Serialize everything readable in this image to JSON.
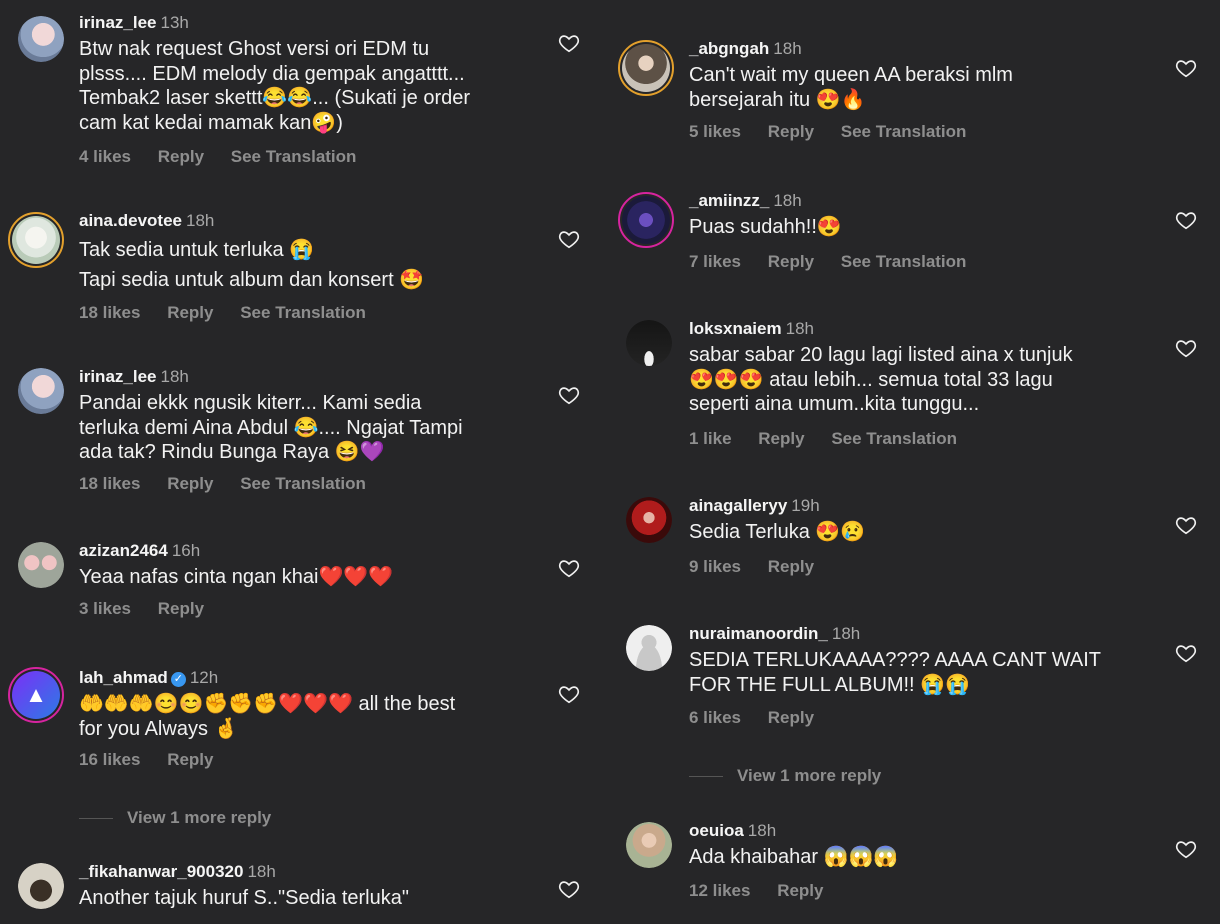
{
  "labels": {
    "reply": "Reply",
    "see_translation": "See Translation"
  },
  "left": {
    "comments": [
      {
        "user": "irinaz_lee",
        "time": "13h",
        "lines": [
          "Btw nak request Ghost versi ori EDM tu",
          "plsss.... EDM melody dia gempak angatttt...",
          "Tembak2 laser skettt😂😂... (Sukati je order",
          "cam kat kedai mamak kan🤪)"
        ],
        "likes": "4 likes",
        "reply": "Reply",
        "translate": "See Translation"
      },
      {
        "user": "aina.devotee",
        "time": "18h",
        "lines": [
          "Tak sedia untuk terluka 😭",
          "Tapi sedia untuk album dan konsert 🤩"
        ],
        "likes": "18 likes",
        "reply": "Reply",
        "translate": "See Translation"
      },
      {
        "user": "irinaz_lee",
        "time": "18h",
        "lines": [
          "Pandai ekkk ngusik kiterr... Kami sedia",
          "terluka demi Aina Abdul 😂.... Ngajat Tampi",
          "ada tak? Rindu Bunga Raya 😆💜"
        ],
        "likes": "18 likes",
        "reply": "Reply",
        "translate": "See Translation"
      },
      {
        "user": "azizan2464",
        "time": "16h",
        "lines": [
          "Yeaa nafas cinta ngan khai❤️❤️❤️"
        ],
        "likes": "3 likes",
        "reply": "Reply"
      },
      {
        "user": "lah_ahmad",
        "time": "12h",
        "verified": "✓",
        "lines": [
          "🤲🤲🤲😊😊✊✊✊❤️❤️❤️ all the best",
          "for you Always 🤞"
        ],
        "likes": "16 likes",
        "reply": "Reply",
        "more_reply": "View 1 more reply"
      },
      {
        "user": "_fikahanwar_900320",
        "time": "18h",
        "lines": [
          "Another tajuk huruf S..\"Sedia terluka\""
        ]
      }
    ]
  },
  "right": {
    "comments": [
      {
        "user": "_abgngah",
        "time": "18h",
        "lines": [
          "Can't wait my queen AA beraksi mlm",
          "bersejarah itu 😍🔥"
        ],
        "likes": "5 likes",
        "reply": "Reply",
        "translate": "See Translation"
      },
      {
        "user": "_amiinzz_",
        "time": "18h",
        "lines": [
          "Puas sudahh!!😍"
        ],
        "likes": "7 likes",
        "reply": "Reply",
        "translate": "See Translation"
      },
      {
        "user": "loksxnaiem",
        "time": "18h",
        "lines": [
          "sabar sabar 20 lagu lagi listed aina x tunjuk",
          "😍😍😍 atau lebih... semua total 33 lagu",
          "seperti aina umum..kita tunggu..."
        ],
        "likes": "1 like",
        "reply": "Reply",
        "translate": "See Translation"
      },
      {
        "user": "ainagalleryy",
        "time": "19h",
        "lines": [
          "Sedia Terluka 😍😢"
        ],
        "likes": "9 likes",
        "reply": "Reply"
      },
      {
        "user": "nuraimanoordin_",
        "time": "18h",
        "lines": [
          "SEDIA TERLUKAAAA???? AAAA CANT WAIT",
          "FOR THE FULL ALBUM!! 😭😭"
        ],
        "likes": "6 likes",
        "reply": "Reply",
        "more_reply": "View 1 more reply"
      },
      {
        "user": "oeuioa",
        "time": "18h",
        "lines": [
          "Ada khaibahar 😱😱😱"
        ],
        "likes": "12 likes",
        "reply": "Reply"
      }
    ]
  },
  "colors": {
    "background": "#262628",
    "text": "#f5f5f5",
    "muted": "#8e8e8e",
    "story_ring": "#d6249f",
    "verified": "#3897f0"
  }
}
